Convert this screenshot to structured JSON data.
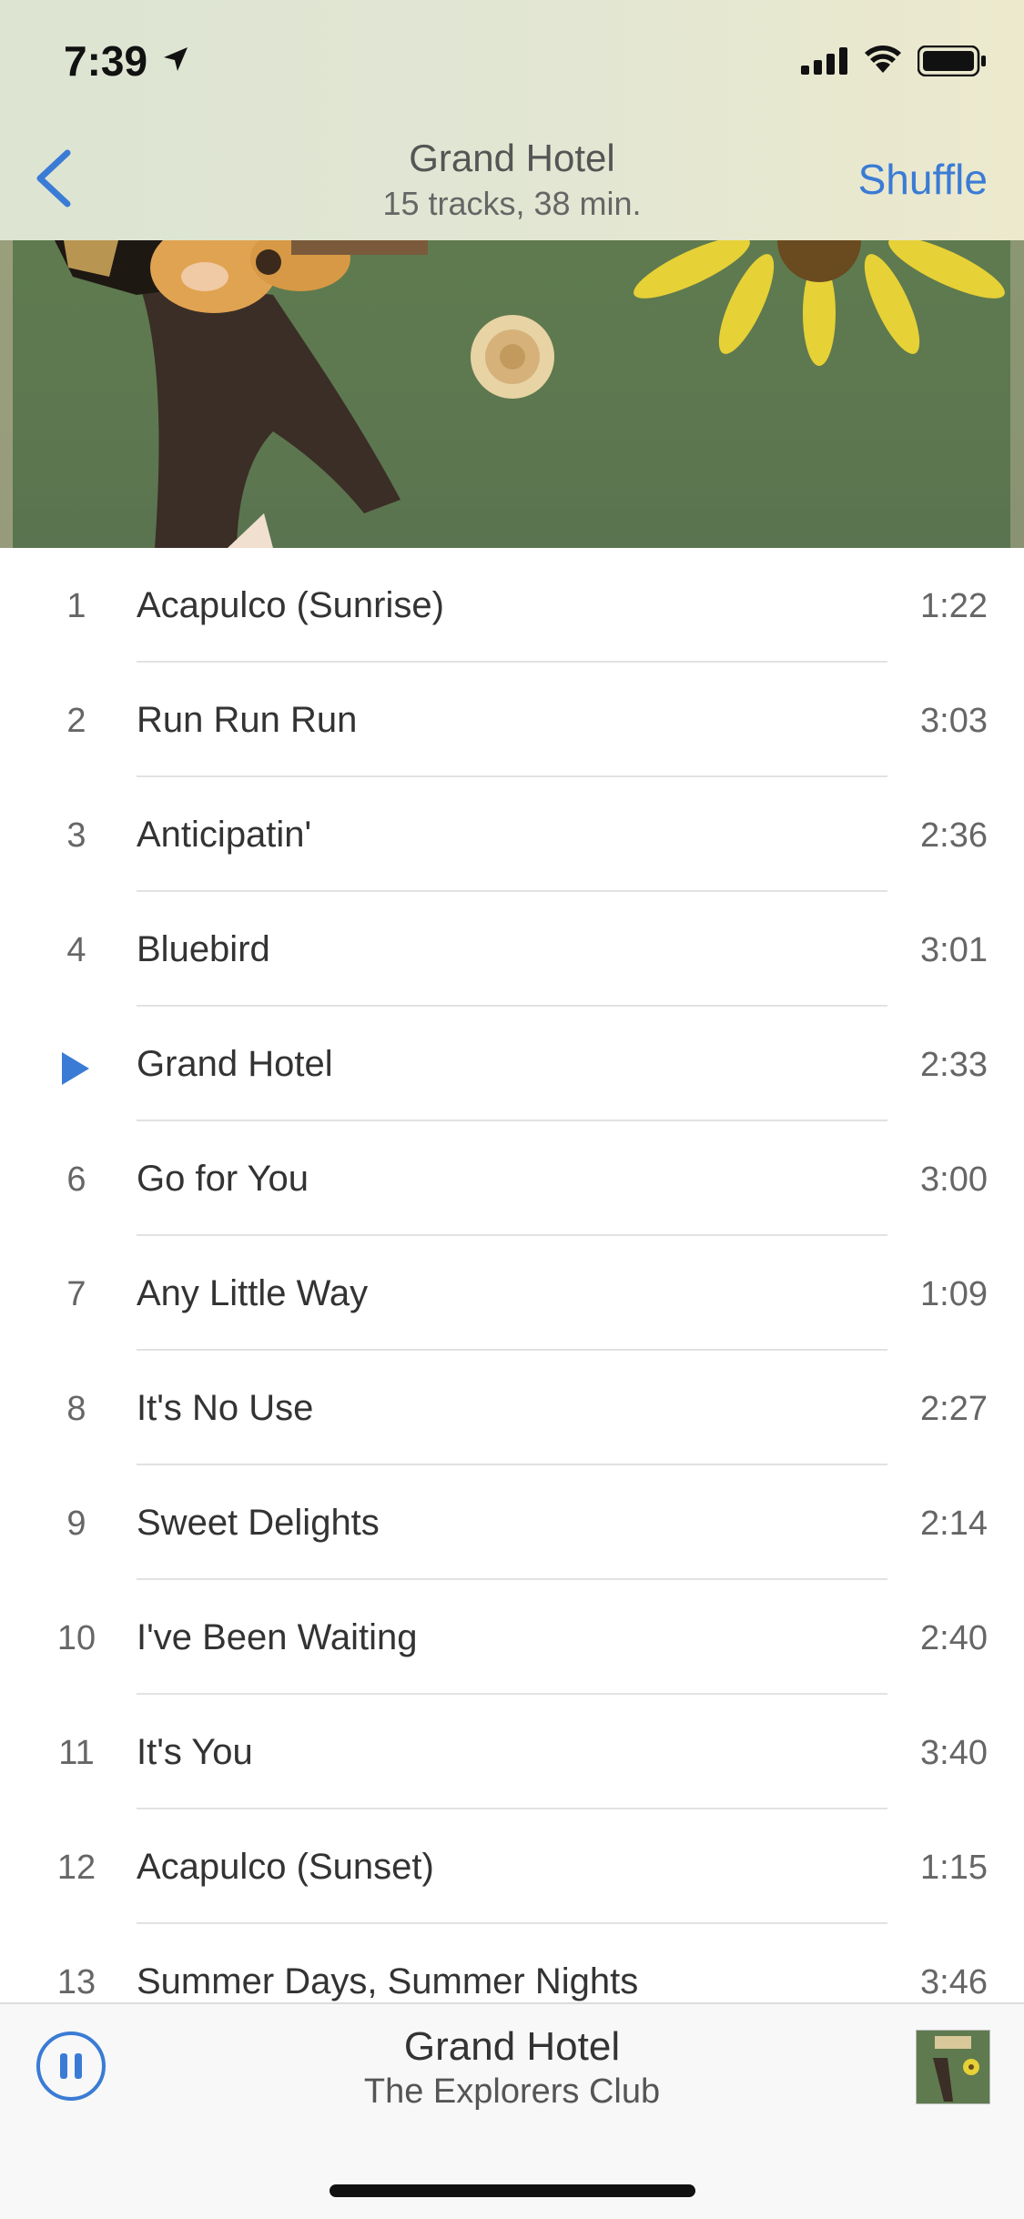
{
  "status_bar": {
    "time": "7:39",
    "icons": [
      "location-arrow-icon",
      "cellular-signal-icon",
      "wifi-icon",
      "battery-icon"
    ]
  },
  "nav": {
    "back_icon": "chevron-left-icon",
    "title": "Grand Hotel",
    "subtitle": "15 tracks, 38 min.",
    "shuffle_label": "Shuffle"
  },
  "colors": {
    "accent": "#3a7bd5",
    "artwork_green": "#5e7950",
    "header_bg": "#e1e6d3"
  },
  "tracks": [
    {
      "number": "1",
      "title": "Acapulco (Sunrise)",
      "duration": "1:22",
      "playing": false
    },
    {
      "number": "2",
      "title": "Run Run Run",
      "duration": "3:03",
      "playing": false
    },
    {
      "number": "3",
      "title": "Anticipatin'",
      "duration": "2:36",
      "playing": false
    },
    {
      "number": "4",
      "title": "Bluebird",
      "duration": "3:01",
      "playing": false
    },
    {
      "number": "",
      "title": "Grand Hotel",
      "duration": "2:33",
      "playing": true
    },
    {
      "number": "6",
      "title": "Go for You",
      "duration": "3:00",
      "playing": false
    },
    {
      "number": "7",
      "title": "Any Little Way",
      "duration": "1:09",
      "playing": false
    },
    {
      "number": "8",
      "title": "It's No Use",
      "duration": "2:27",
      "playing": false
    },
    {
      "number": "9",
      "title": "Sweet Delights",
      "duration": "2:14",
      "playing": false
    },
    {
      "number": "10",
      "title": "I've Been Waiting",
      "duration": "2:40",
      "playing": false
    },
    {
      "number": "11",
      "title": "It's You",
      "duration": "3:40",
      "playing": false
    },
    {
      "number": "12",
      "title": "Acapulco (Sunset)",
      "duration": "1:15",
      "playing": false
    },
    {
      "number": "13",
      "title": "Summer Days, Summer Nights",
      "duration": "3:46",
      "playing": false
    }
  ],
  "now_playing": {
    "title": "Grand Hotel",
    "artist": "The Explorers Club",
    "control_icon": "pause-icon"
  }
}
